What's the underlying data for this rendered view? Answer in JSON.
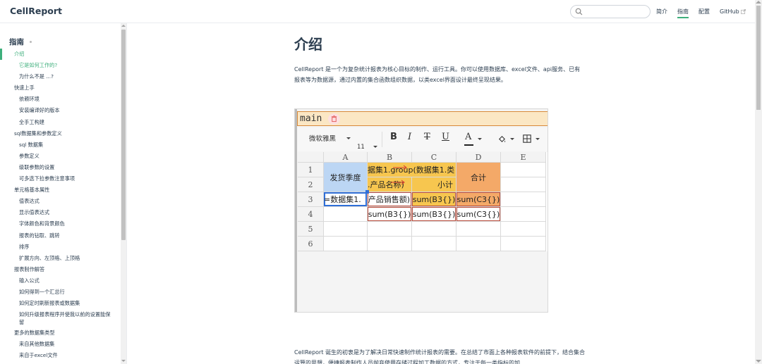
{
  "app": {
    "title": "CellReport"
  },
  "search": {
    "placeholder": ""
  },
  "nav": {
    "items": [
      {
        "label": "简介"
      },
      {
        "label": "指南"
      },
      {
        "label": "配置"
      },
      {
        "label": "GitHub"
      }
    ]
  },
  "sidebar": {
    "heading": "指南",
    "items": [
      {
        "label": "介绍"
      },
      {
        "label": "它是如何工作的?"
      },
      {
        "label": "为什么不是 ...?"
      },
      {
        "label": "快速上手"
      },
      {
        "label": "依赖环境"
      },
      {
        "label": "安装编译好的版本"
      },
      {
        "label": "全手工构建"
      },
      {
        "label": "sql数据集和参数定义"
      },
      {
        "label": "sql 数据集"
      },
      {
        "label": "参数定义"
      },
      {
        "label": "级联参数的设置"
      },
      {
        "label": "可多选下拉参数注意事项"
      },
      {
        "label": "单元格基本属性"
      },
      {
        "label": "值表达式"
      },
      {
        "label": "显示值表达式"
      },
      {
        "label": "字体颜色和背景颜色"
      },
      {
        "label": "报表的钻取、跳转"
      },
      {
        "label": "排序"
      },
      {
        "label": "扩展方向、左顶格、上顶格"
      },
      {
        "label": "报表制作解答"
      },
      {
        "label": "输入公式"
      },
      {
        "label": "如何得到一个汇总行"
      },
      {
        "label": "如何定时刷新报表或数据集"
      },
      {
        "label": "如何升级报表程序并使我以前的设置能保留"
      },
      {
        "label": "更多的数据集类型"
      },
      {
        "label": "来自其他数据集"
      },
      {
        "label": "来自于excel文件"
      }
    ]
  },
  "content": {
    "title": "介绍",
    "intro": "CellReport 是一个为复杂统计报表为核心目标的制作、运行工具。你可以使用数据库、excel文件、api服务、已有报表等为数据源，通过内置的集合函数组织数据，以类excel界面设计最终呈现结果。",
    "para2": "CellReport 诞生的初衷是为了解决日常快速制作统计报表的需要。在总结了市面上各种报表软件的前提下，结合集合运算的思想，便捷报表制作人员抛弃使用存储过程加工数据的方式，专注于每一类指标的加"
  },
  "screenshot": {
    "tab_label": "main",
    "toolbar": {
      "font": "微软雅黑",
      "size": "11",
      "bold": "B",
      "italic": "I",
      "strike": "T",
      "underline": "U",
      "color": "A"
    },
    "columns": [
      "A",
      "B",
      "C",
      "D",
      "E"
    ],
    "rows": [
      "1",
      "2",
      "3",
      "4",
      "5",
      "6"
    ],
    "cells": {
      "A1": "发货季度",
      "B1": "据集1.group(数据集1.类",
      "D1": "合计",
      "B2": ".产品名称)",
      "C2": "小计",
      "A3": "=数据集1.",
      "B3": "产品销售额)",
      "C3": "sum(B3{})",
      "D3": "sum(C3{})",
      "B4": "sum(B3{})",
      "C4": "sum(B3{})",
      "D4": "sum(C3{})"
    }
  }
}
